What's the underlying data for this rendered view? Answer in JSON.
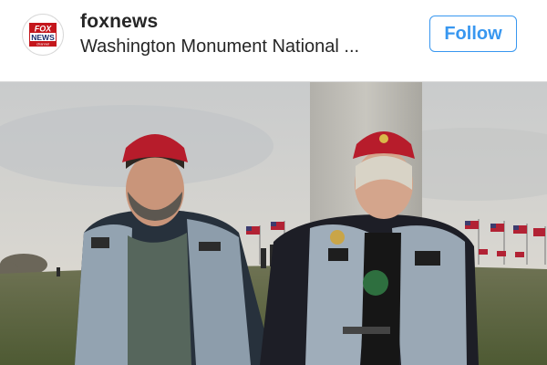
{
  "post": {
    "username": "foxnews",
    "location": "Washington Monument National ...",
    "follow_label": "Follow",
    "avatar": {
      "logo_text": "FOX",
      "logo_subtext": "NEWS",
      "logo_tag": "channel",
      "colors": {
        "red": "#c4161c",
        "white": "#ffffff",
        "blue": "#1a2b6b"
      }
    },
    "accent_color": "#3897f0"
  },
  "photo": {
    "icon": "photo-image"
  }
}
